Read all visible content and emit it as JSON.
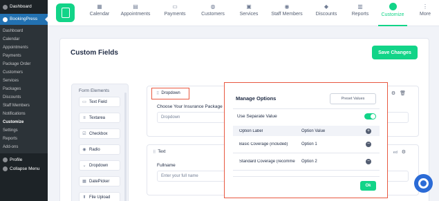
{
  "wp_sidebar": {
    "dashboard": "Dashboard",
    "plugin": "BookingPress",
    "submenu": [
      "Dashboard",
      "Calendar",
      "Appointments",
      "Payments",
      "Package Order",
      "Customers",
      "Services",
      "Packages",
      "Discounts",
      "Staff Members",
      "Notifications",
      "Customize",
      "Settings",
      "Reports",
      "Add-ons"
    ],
    "current": "Customize",
    "profile": "Profile",
    "collapse": "Collapse Menu"
  },
  "topnav": {
    "items": [
      {
        "label": "Calendar",
        "icon": "calendar-icon"
      },
      {
        "label": "Appointments",
        "icon": "appointments-icon"
      },
      {
        "label": "Payments",
        "icon": "payments-icon"
      },
      {
        "label": "Customers",
        "icon": "customers-icon"
      },
      {
        "label": "Services",
        "icon": "services-icon"
      },
      {
        "label": "Staff Members",
        "icon": "staff-icon"
      },
      {
        "label": "Discounts",
        "icon": "discounts-icon"
      },
      {
        "label": "Reports",
        "icon": "reports-icon"
      },
      {
        "label": "Customize",
        "icon": "customize-icon"
      },
      {
        "label": "More",
        "icon": "more-icon"
      }
    ],
    "active": "Customize"
  },
  "page": {
    "title": "Custom Fields",
    "save_label": "Save Changes"
  },
  "form_elements": {
    "title": "Form Elements",
    "items": [
      "Text Field",
      "Textarea",
      "Checkbox",
      "Radio",
      "Dropdown",
      "DatePicker",
      "File Upload"
    ]
  },
  "fields": {
    "dropdown": {
      "type": "Dropdown",
      "label": "Choose Your Insurance Package",
      "placeholder": "Dropdown"
    },
    "text": {
      "type": "Text",
      "label": "Fullname",
      "placeholder": "Enter your full name",
      "suffix": "ed"
    }
  },
  "modal": {
    "title": "Manage Options",
    "preset_label": "Preset Values",
    "separate_label": "Use Separate Value",
    "separate_on": true,
    "col_label": "Option Label",
    "col_value": "Option Value",
    "options": [
      {
        "label": "Basic Coverage (included)",
        "value": "Option 1"
      },
      {
        "label": "Standard Coverage (recomme",
        "value": "Option 2"
      }
    ],
    "ok_label": "Ok"
  },
  "colors": {
    "accent": "#12d488",
    "highlight": "#e8573f",
    "wp_dark": "#1d2327",
    "wp_blue": "#2271b1",
    "help": "#2b6bd6"
  }
}
